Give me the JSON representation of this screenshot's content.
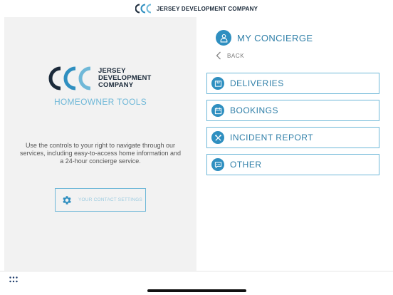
{
  "header": {
    "brand": "JERSEY DEVELOPMENT COMPANY"
  },
  "left_panel": {
    "logo_lines": [
      "JERSEY",
      "DEVELOPMENT",
      "COMPANY"
    ],
    "title": "HOMEOWNER TOOLS",
    "intro": "Use the controls to your right to navigate through our services, including easy-to-access home information and a 24-hour concierge service.",
    "contact_button": "YOUR CONTACT SETTINGS"
  },
  "right_panel": {
    "title": "MY CONCIERGE",
    "back_label": "BACK",
    "items": [
      {
        "label": "DELIVERIES",
        "icon": "package-icon"
      },
      {
        "label": "BOOKINGS",
        "icon": "calendar-icon"
      },
      {
        "label": "INCIDENT REPORT",
        "icon": "tools-icon"
      },
      {
        "label": "OTHER",
        "icon": "chat-icon"
      }
    ]
  },
  "colors": {
    "accent": "#2f8fc0",
    "accent_light": "#6fb8d8",
    "navy": "#1b2a3a",
    "panel_bg": "#f2f2f2"
  }
}
